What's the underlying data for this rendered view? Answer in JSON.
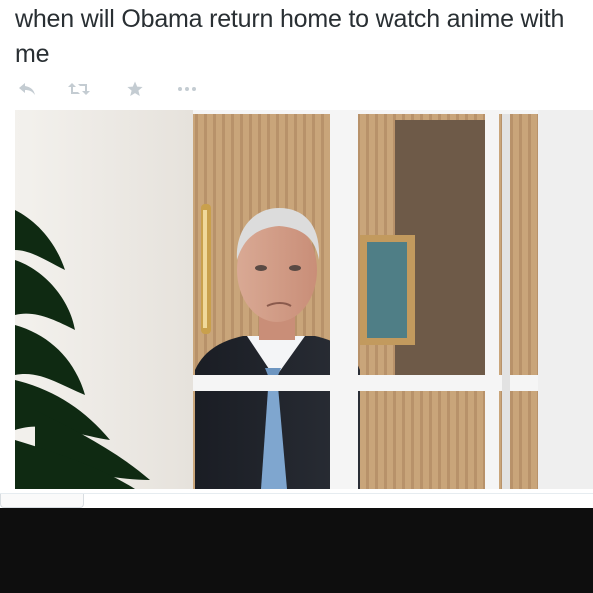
{
  "tweet": {
    "text": "when will Obama return home to watch anime with me"
  },
  "actions": [
    {
      "name": "reply-icon",
      "label": "Reply"
    },
    {
      "name": "retweet-icon",
      "label": "Retweet"
    },
    {
      "name": "favorite-icon",
      "label": "Favorite"
    },
    {
      "name": "more-icon",
      "label": "More"
    }
  ],
  "colors": {
    "text": "#292f33",
    "icon": "#c4ccd2",
    "bottom_bar": "#0e0e0e"
  }
}
